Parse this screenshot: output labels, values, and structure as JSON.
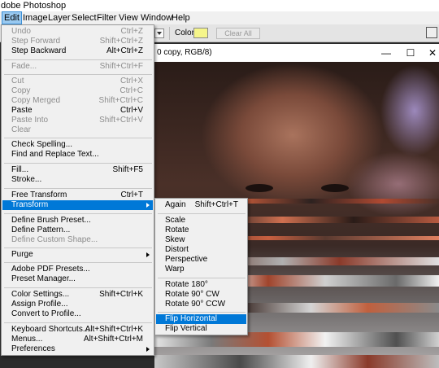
{
  "app": {
    "title": "dobe Photoshop"
  },
  "menubar": {
    "items": [
      {
        "label": "Edit",
        "active": true
      },
      {
        "label": "Image"
      },
      {
        "label": "Layer"
      },
      {
        "label": "Select"
      },
      {
        "label": "Filter"
      },
      {
        "label": "View"
      },
      {
        "label": "Window"
      },
      {
        "label": "Help"
      }
    ]
  },
  "options": {
    "color_label": "Color:",
    "swatch_color": "#f5f58a",
    "clear_all": "Clear All",
    "panel_icon": "panel-icon"
  },
  "document": {
    "title": "0 copy, RGB/8)",
    "minimize": "—",
    "maximize": "☐",
    "close": "✕"
  },
  "edit_menu": {
    "items": [
      {
        "label": "Undo",
        "shortcut": "Ctrl+Z",
        "disabled": true
      },
      {
        "label": "Step Forward",
        "shortcut": "Shift+Ctrl+Z",
        "disabled": true
      },
      {
        "label": "Step Backward",
        "shortcut": "Alt+Ctrl+Z"
      },
      {
        "label": "Fade...",
        "shortcut": "Shift+Ctrl+F",
        "disabled": true
      },
      {
        "label": "Cut",
        "shortcut": "Ctrl+X",
        "disabled": true
      },
      {
        "label": "Copy",
        "shortcut": "Ctrl+C",
        "disabled": true
      },
      {
        "label": "Copy Merged",
        "shortcut": "Shift+Ctrl+C",
        "disabled": true
      },
      {
        "label": "Paste",
        "shortcut": "Ctrl+V"
      },
      {
        "label": "Paste Into",
        "shortcut": "Shift+Ctrl+V",
        "disabled": true
      },
      {
        "label": "Clear",
        "shortcut": "",
        "disabled": true
      },
      {
        "label": "Check Spelling...",
        "shortcut": ""
      },
      {
        "label": "Find and Replace Text...",
        "shortcut": ""
      },
      {
        "label": "Fill...",
        "shortcut": "Shift+F5"
      },
      {
        "label": "Stroke...",
        "shortcut": ""
      },
      {
        "label": "Free Transform",
        "shortcut": "Ctrl+T"
      },
      {
        "label": "Transform",
        "shortcut": "",
        "submenu": true,
        "highlighted": true
      },
      {
        "label": "Define Brush Preset...",
        "shortcut": ""
      },
      {
        "label": "Define Pattern...",
        "shortcut": ""
      },
      {
        "label": "Define Custom Shape...",
        "shortcut": "",
        "disabled": true
      },
      {
        "label": "Purge",
        "shortcut": "",
        "submenu": true
      },
      {
        "label": "Adobe PDF Presets...",
        "shortcut": ""
      },
      {
        "label": "Preset Manager...",
        "shortcut": ""
      },
      {
        "label": "Color Settings...",
        "shortcut": "Shift+Ctrl+K"
      },
      {
        "label": "Assign Profile...",
        "shortcut": ""
      },
      {
        "label": "Convert to Profile...",
        "shortcut": ""
      },
      {
        "label": "Keyboard Shortcuts...",
        "shortcut": "Alt+Shift+Ctrl+K"
      },
      {
        "label": "Menus...",
        "shortcut": "Alt+Shift+Ctrl+M"
      },
      {
        "label": "Preferences",
        "shortcut": "",
        "submenu": true
      }
    ]
  },
  "transform_menu": {
    "items": [
      {
        "label": "Again",
        "shortcut": "Shift+Ctrl+T"
      },
      {
        "label": "Scale",
        "shortcut": ""
      },
      {
        "label": "Rotate",
        "shortcut": ""
      },
      {
        "label": "Skew",
        "shortcut": ""
      },
      {
        "label": "Distort",
        "shortcut": ""
      },
      {
        "label": "Perspective",
        "shortcut": ""
      },
      {
        "label": "Warp",
        "shortcut": ""
      },
      {
        "label": "Rotate 180°",
        "shortcut": ""
      },
      {
        "label": "Rotate 90° CW",
        "shortcut": ""
      },
      {
        "label": "Rotate 90° CCW",
        "shortcut": ""
      },
      {
        "label": "Flip Horizontal",
        "shortcut": "",
        "highlighted": true
      },
      {
        "label": "Flip Vertical",
        "shortcut": ""
      }
    ]
  }
}
